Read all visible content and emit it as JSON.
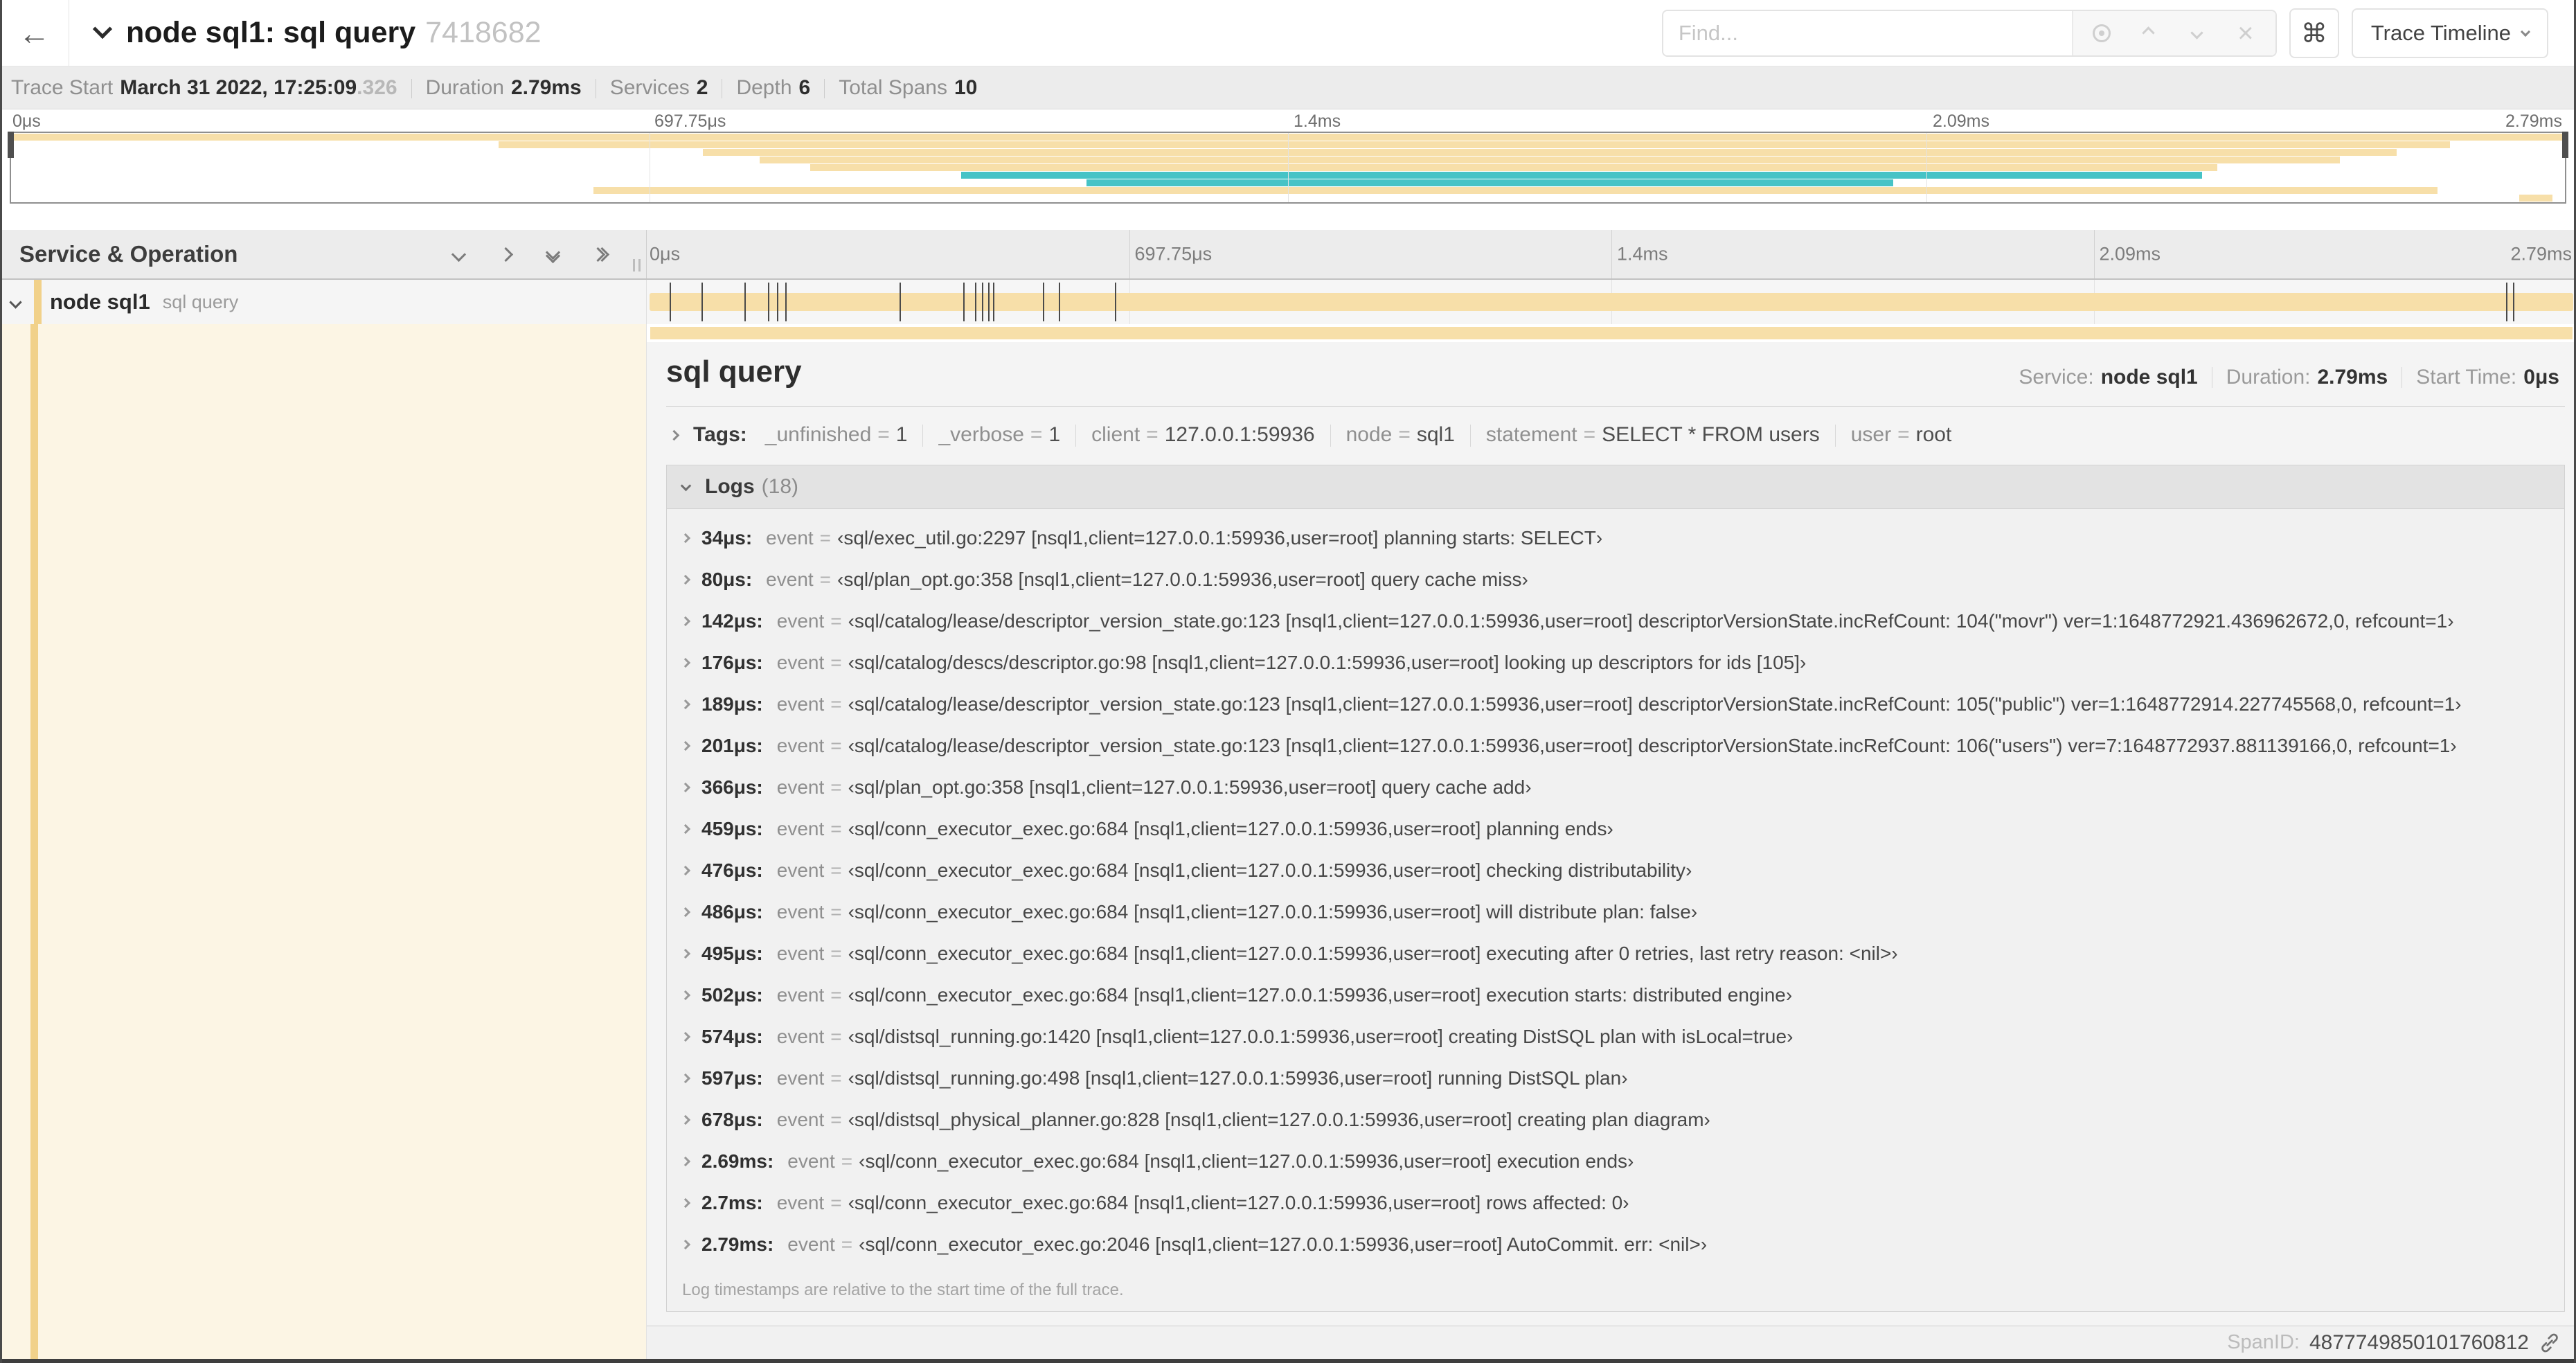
{
  "header": {
    "back_glyph": "←",
    "title": "node sql1: sql query",
    "trace_id_short": "7418682",
    "find_placeholder": "Find...",
    "clear_glyph": "×",
    "shortcut_glyph": "⌘",
    "view_label": "Trace Timeline"
  },
  "summary": {
    "items": [
      {
        "label": "Trace Start",
        "value": "March 31 2022, 17:25:09",
        "suffix": ".326"
      },
      {
        "label": "Duration",
        "value": "2.79ms"
      },
      {
        "label": "Services",
        "value": "2"
      },
      {
        "label": "Depth",
        "value": "6"
      },
      {
        "label": "Total Spans",
        "value": "10"
      }
    ]
  },
  "colors": {
    "tan": "#f7dfa9",
    "teal": "#46c3c6",
    "stripe": "#f1d18a",
    "cream": "#fcf5e4"
  },
  "timeline": {
    "ruler_ticks": [
      "0μs",
      "697.75μs",
      "1.4ms",
      "2.09ms",
      "2.79ms"
    ],
    "minimap_spans": [
      {
        "color": "tan",
        "left": 0,
        "width": 100
      },
      {
        "color": "tan",
        "left": 19.1,
        "width": 76.4
      },
      {
        "color": "tan",
        "left": 27.1,
        "width": 66.3
      },
      {
        "color": "tan",
        "left": 29.3,
        "width": 61.9
      },
      {
        "color": "tan",
        "left": 31.3,
        "width": 55.1
      },
      {
        "color": "teal",
        "left": 37.2,
        "width": 48.6
      },
      {
        "color": "teal",
        "left": 42.1,
        "width": 31.6
      },
      {
        "color": "tan",
        "left": 22.8,
        "width": 72.2
      },
      {
        "color": "tan",
        "left": 98.2,
        "width": 1.3
      }
    ],
    "header": {
      "title": "Service & Operation"
    },
    "span_row": {
      "service": "node sql1",
      "operation": "sql query",
      "bar_left": 0.15,
      "bar_width": 99.7,
      "log_marker_positions_pct": [
        1.22,
        2.87,
        5.09,
        6.31,
        6.77,
        7.2,
        13.12,
        16.45,
        17.06,
        17.42,
        17.74,
        17.99,
        20.57,
        21.4,
        24.3,
        96.42,
        96.77,
        99.93
      ]
    }
  },
  "detail": {
    "operation": "sql query",
    "meta": [
      {
        "label": "Service:",
        "value": "node sql1"
      },
      {
        "label": "Duration:",
        "value": "2.79ms"
      },
      {
        "label": "Start Time:",
        "value": "0μs"
      }
    ],
    "tags_label": "Tags:",
    "tags_eq": "=",
    "tags": [
      {
        "key": "_unfinished",
        "value": "1"
      },
      {
        "key": "_verbose",
        "value": "1"
      },
      {
        "key": "client",
        "value": "127.0.0.1:59936"
      },
      {
        "key": "node",
        "value": "sql1"
      },
      {
        "key": "statement",
        "value": "SELECT * FROM users"
      },
      {
        "key": "user",
        "value": "root"
      }
    ],
    "logs": {
      "title": "Logs",
      "count": "(18)",
      "eq": "=",
      "rows": [
        {
          "time": "34μs:",
          "key": "event",
          "value": "‹sql/exec_util.go:2297 [nsql1,client=127.0.0.1:59936,user=root] planning starts: SELECT›"
        },
        {
          "time": "80μs:",
          "key": "event",
          "value": "‹sql/plan_opt.go:358 [nsql1,client=127.0.0.1:59936,user=root] query cache miss›"
        },
        {
          "time": "142μs:",
          "key": "event",
          "value": "‹sql/catalog/lease/descriptor_version_state.go:123 [nsql1,client=127.0.0.1:59936,user=root] descriptorVersionState.incRefCount: 104(\"movr\") ver=1:1648772921.436962672,0, refcount=1›"
        },
        {
          "time": "176μs:",
          "key": "event",
          "value": "‹sql/catalog/descs/descriptor.go:98 [nsql1,client=127.0.0.1:59936,user=root] looking up descriptors for ids [105]›"
        },
        {
          "time": "189μs:",
          "key": "event",
          "value": "‹sql/catalog/lease/descriptor_version_state.go:123 [nsql1,client=127.0.0.1:59936,user=root] descriptorVersionState.incRefCount: 105(\"public\") ver=1:1648772914.227745568,0, refcount=1›"
        },
        {
          "time": "201μs:",
          "key": "event",
          "value": "‹sql/catalog/lease/descriptor_version_state.go:123 [nsql1,client=127.0.0.1:59936,user=root] descriptorVersionState.incRefCount: 106(\"users\") ver=7:1648772937.881139166,0, refcount=1›"
        },
        {
          "time": "366μs:",
          "key": "event",
          "value": "‹sql/plan_opt.go:358 [nsql1,client=127.0.0.1:59936,user=root] query cache add›"
        },
        {
          "time": "459μs:",
          "key": "event",
          "value": "‹sql/conn_executor_exec.go:684 [nsql1,client=127.0.0.1:59936,user=root] planning ends›"
        },
        {
          "time": "476μs:",
          "key": "event",
          "value": "‹sql/conn_executor_exec.go:684 [nsql1,client=127.0.0.1:59936,user=root] checking distributability›"
        },
        {
          "time": "486μs:",
          "key": "event",
          "value": "‹sql/conn_executor_exec.go:684 [nsql1,client=127.0.0.1:59936,user=root] will distribute plan: false›"
        },
        {
          "time": "495μs:",
          "key": "event",
          "value": "‹sql/conn_executor_exec.go:684 [nsql1,client=127.0.0.1:59936,user=root] executing after 0 retries, last retry reason: <nil>›"
        },
        {
          "time": "502μs:",
          "key": "event",
          "value": "‹sql/conn_executor_exec.go:684 [nsql1,client=127.0.0.1:59936,user=root] execution starts: distributed engine›"
        },
        {
          "time": "574μs:",
          "key": "event",
          "value": "‹sql/distsql_running.go:1420 [nsql1,client=127.0.0.1:59936,user=root] creating DistSQL plan with isLocal=true›"
        },
        {
          "time": "597μs:",
          "key": "event",
          "value": "‹sql/distsql_running.go:498 [nsql1,client=127.0.0.1:59936,user=root] running DistSQL plan›"
        },
        {
          "time": "678μs:",
          "key": "event",
          "value": "‹sql/distsql_physical_planner.go:828 [nsql1,client=127.0.0.1:59936,user=root] creating plan diagram›"
        },
        {
          "time": "2.69ms:",
          "key": "event",
          "value": "‹sql/conn_executor_exec.go:684 [nsql1,client=127.0.0.1:59936,user=root] execution ends›"
        },
        {
          "time": "2.7ms:",
          "key": "event",
          "value": "‹sql/conn_executor_exec.go:684 [nsql1,client=127.0.0.1:59936,user=root] rows affected: 0›"
        },
        {
          "time": "2.79ms:",
          "key": "event",
          "value": "‹sql/conn_executor_exec.go:2046 [nsql1,client=127.0.0.1:59936,user=root] AutoCommit. err: <nil>›"
        }
      ],
      "footer": "Log timestamps are relative to the start time of the full trace."
    },
    "span_id_label": "SpanID:",
    "span_id": "4877749850101760812"
  }
}
